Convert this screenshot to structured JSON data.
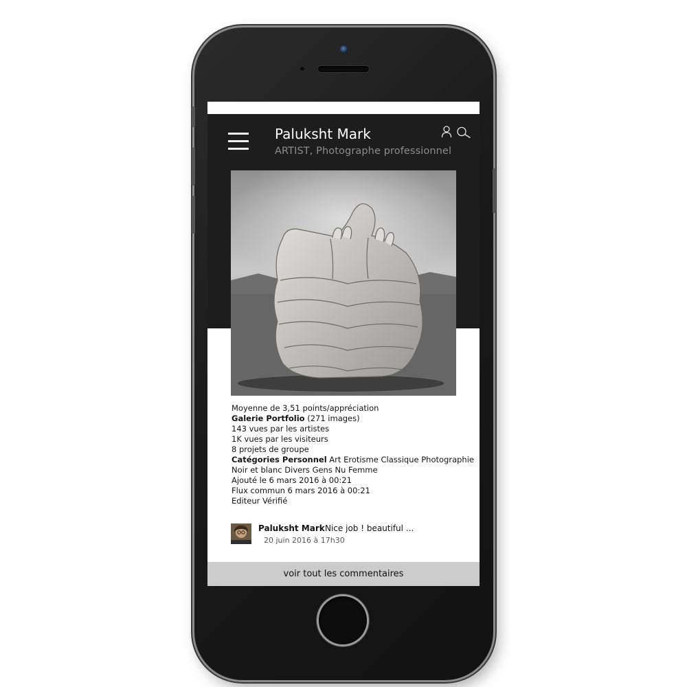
{
  "header": {
    "title": "Paluksht Mark",
    "subtitle": "ARTIST, Photographe professionnel"
  },
  "icons": {
    "menu": "hamburger-icon",
    "user": "user-icon",
    "search": "search-icon"
  },
  "details": {
    "rating": "Moyenne de 3,51 points/appréciation",
    "gallery_label": "Galerie Portfolio",
    "gallery_count": " (271 images)",
    "artist_views": "143 vues par les artistes",
    "visitor_views": "1K vues par les visiteurs",
    "group_projects": "8 projets de groupe",
    "categories_label": "Catégories Personnel",
    "categories_line1": " Art Erotisme Classique Photographie",
    "categories_line2": "Noir et blanc Divers Gens Nu Femme",
    "added": "Ajouté le 6 mars 2016 à 00:21",
    "feed": "Flux commun 6 mars 2016 à 00:21",
    "editor": "Editeur Vérifié"
  },
  "comment": {
    "author": "Paluksht Mark",
    "text": "Nice job ! beautiful ...",
    "date": "20 juin 2016 à 17h30"
  },
  "footer": {
    "view_all_label": "voir tout les commentaires"
  },
  "colors": {
    "screen_bg": "#1d1d1d",
    "subtitle": "#8c8c8c",
    "footer_bg": "#cbcbcb"
  }
}
